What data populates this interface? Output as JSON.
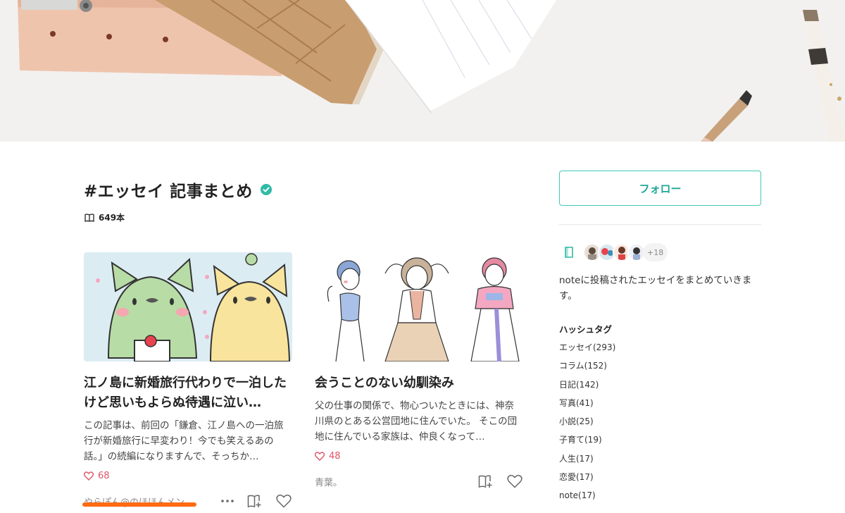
{
  "magazine": {
    "title": "#エッセイ 記事まとめ",
    "count": "649本"
  },
  "articles": [
    {
      "title": "江ノ島に新婚旅行代わりで一泊したけど思いもよらぬ待遇に泣い…",
      "excerpt": "この記事は、前回の「鎌倉、江ノ島への一泊旅行が新婚旅行に早変わり！今でも笑えるあの話。」の続編になりますんで、そっちか…",
      "likes": "68",
      "author": "やらぽん@のほほんメン…"
    },
    {
      "title": "会うことのない幼馴染み",
      "excerpt": "父の仕事の関係で、物心ついたときには、神奈川県のとある公営団地に住んでいた。 そこの団地に住んでいる家族は、仲良くなって…",
      "likes": "48",
      "author": "青葉。"
    }
  ],
  "sidebar": {
    "follow_label": "フォロー",
    "member_extra": "+18",
    "description": "noteに投稿されたエッセイをまとめていきます。",
    "hashtags_heading": "ハッシュタグ",
    "hashtags": [
      "エッセイ(293)",
      "コラム(152)",
      "日記(142)",
      "写真(41)",
      "小説(25)",
      "子育て(19)",
      "人生(17)",
      "恋愛(17)",
      "note(17)"
    ]
  },
  "colors": {
    "accent": "#41c9b4",
    "like": "#e05567",
    "highlight": "#ff6a13"
  },
  "icons": {
    "verified": "check-badge-icon",
    "count": "book-icon",
    "like": "heart-icon",
    "more": "ellipsis-icon",
    "add_to_magazine": "magazine-add-icon",
    "magazine": "magazine-icon"
  }
}
